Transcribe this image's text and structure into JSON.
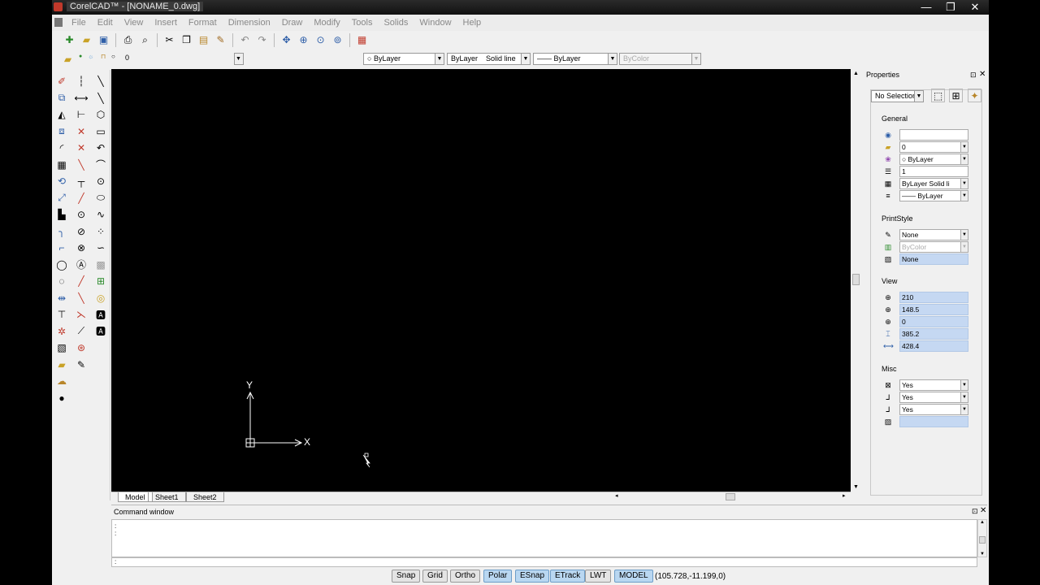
{
  "window": {
    "title": "CorelCAD™ - [NONAME_0.dwg]",
    "controls": [
      "—",
      "❐",
      "✕"
    ]
  },
  "menu": [
    "File",
    "Edit",
    "View",
    "Insert",
    "Format",
    "Dimension",
    "Draw",
    "Modify",
    "Tools",
    "Solids",
    "Window",
    "Help"
  ],
  "layer_bar": {
    "layer_name": "0",
    "color": "ByLayer",
    "linestyle_layer": "ByLayer",
    "linestyle_name": "Solid line",
    "lineweight": "—— ByLayer",
    "printstyle": "ByColor"
  },
  "drawing": {
    "ucs_x_label": "X",
    "ucs_y_label": "Y",
    "sheets": [
      "Model",
      "Sheet1",
      "Sheet2"
    ]
  },
  "properties": {
    "title": "Properties",
    "selection": "No Selection",
    "general_label": "General",
    "general": {
      "color": "",
      "layer": "0",
      "color_value": "○ ByLayer",
      "linetype_scale": "1",
      "linestyle": "ByLayer    Solid li",
      "lineweight": "—— ByLayer"
    },
    "printstyle_label": "PrintStyle",
    "printstyle": {
      "style": "None",
      "table": "ByColor",
      "attached": "None"
    },
    "view_label": "View",
    "view": {
      "center_x": "210",
      "center_y": "148.5",
      "center_z": "0",
      "height": "385.2",
      "width": "428.4"
    },
    "misc_label": "Misc",
    "misc": {
      "ucs_icon_on": "Yes",
      "ucs_icon_origin": "Yes",
      "ucs_per_viewport": "Yes",
      "ucs_name": ""
    }
  },
  "command_window": {
    "title": "Command window",
    "log": [
      ":",
      ":"
    ],
    "prompt": ":"
  },
  "status": {
    "buttons": [
      {
        "label": "Snap",
        "on": false
      },
      {
        "label": "Grid",
        "on": false
      },
      {
        "label": "Ortho",
        "on": false
      },
      {
        "label": "Polar",
        "on": true
      },
      {
        "label": "ESnap",
        "on": true
      },
      {
        "label": "ETrack",
        "on": true
      },
      {
        "label": "LWT",
        "on": false
      },
      {
        "label": "MODEL",
        "on": true
      }
    ],
    "coords": "(105.728,-11.199,0)"
  },
  "colors": {
    "canvas": "#000000",
    "highlight": "#c5d8f2",
    "status_on": "#b9d7f1"
  }
}
